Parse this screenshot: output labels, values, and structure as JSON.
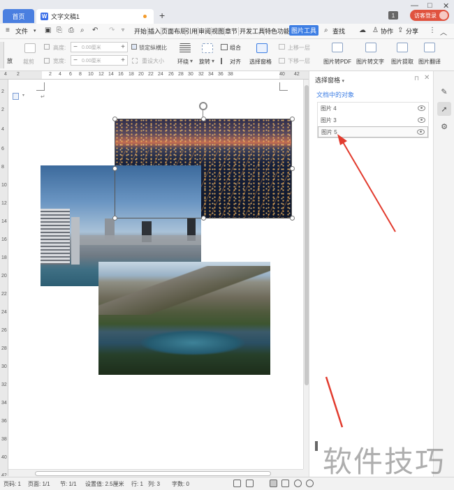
{
  "tabs": {
    "home": "首页",
    "document": "文字文稿1",
    "unsaved_dot_color": "#f39b2b",
    "new_tab": "+"
  },
  "window": {
    "badge": "1",
    "login": "访客登录"
  },
  "menu": {
    "file": "文件",
    "items": [
      "开始",
      "插入",
      "页面布局",
      "引用",
      "审阅",
      "视图",
      "章节",
      "开发工具",
      "特色功能",
      "图片工具"
    ],
    "active": "图片工具",
    "search": "查找",
    "collab": "协作",
    "share": "分享"
  },
  "ribbon": {
    "left_cut": "放",
    "crop": "裁剪",
    "height_label": "高度:",
    "width_label": "宽度:",
    "height_value": "0.00厘米",
    "width_value": "0.00厘米",
    "lock_ratio": "锁定纵横比",
    "reset_size": "重设大小",
    "wrap": "环绕",
    "rotate": "旋转",
    "group": "组合",
    "align": "对齐",
    "select_pane": "选择窗格",
    "bring_forward": "上移一层",
    "send_backward": "下移一层",
    "to_pdf": "图片转PDF",
    "to_text": "图片转文字",
    "extract": "图片提取",
    "translate": "图片翻译"
  },
  "ruler": {
    "h": [
      "4",
      "2",
      "",
      "2",
      "4",
      "6",
      "8",
      "10",
      "12",
      "14",
      "16",
      "18",
      "20",
      "22",
      "24",
      "26",
      "28",
      "30",
      "32",
      "34",
      "36",
      "38",
      "",
      "40",
      "42"
    ],
    "v": [
      "2",
      "2",
      "4",
      "6",
      "8",
      "10",
      "12",
      "14",
      "16",
      "18",
      "20",
      "22",
      "24",
      "26",
      "28",
      "30",
      "32",
      "34",
      "36",
      "38",
      "40",
      "42"
    ]
  },
  "panel": {
    "title": "选择窗格",
    "subtitle": "文档中的对象",
    "objects": [
      "图片 4",
      "图片 3",
      "图片 5"
    ],
    "selected": "图片 5"
  },
  "status": {
    "page_no": "页码: 1",
    "pages": "页面: 1/1",
    "section": "节: 1/1",
    "setting": "设置值: 2.5厘米",
    "row": "行: 1",
    "col": "列: 3",
    "words": "字数: 0"
  },
  "watermark": "软件技巧",
  "colors": {
    "accent": "#3d7ee4",
    "arrow": "#e23b2e",
    "login": "#e0533f"
  }
}
